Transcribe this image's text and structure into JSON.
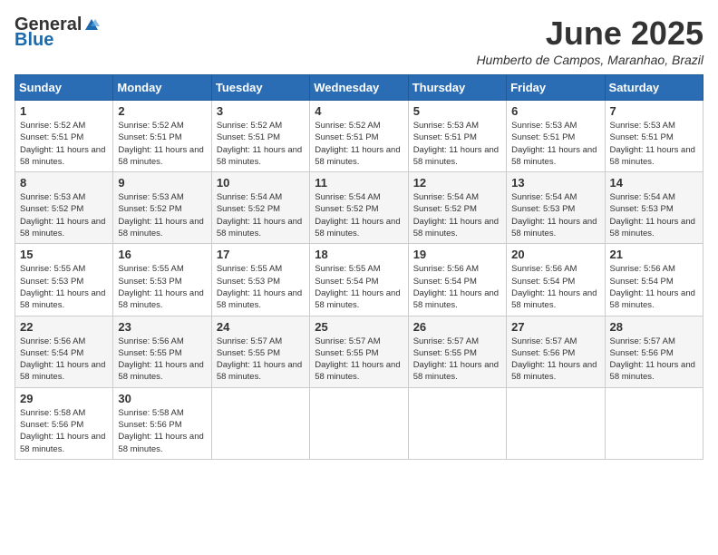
{
  "header": {
    "logo_general": "General",
    "logo_blue": "Blue",
    "month_title": "June 2025",
    "subtitle": "Humberto de Campos, Maranhao, Brazil"
  },
  "weekdays": [
    "Sunday",
    "Monday",
    "Tuesday",
    "Wednesday",
    "Thursday",
    "Friday",
    "Saturday"
  ],
  "weeks": [
    [
      {
        "day": "1",
        "sunrise": "5:52 AM",
        "sunset": "5:51 PM",
        "daylight": "11 hours and 58 minutes."
      },
      {
        "day": "2",
        "sunrise": "5:52 AM",
        "sunset": "5:51 PM",
        "daylight": "11 hours and 58 minutes."
      },
      {
        "day": "3",
        "sunrise": "5:52 AM",
        "sunset": "5:51 PM",
        "daylight": "11 hours and 58 minutes."
      },
      {
        "day": "4",
        "sunrise": "5:52 AM",
        "sunset": "5:51 PM",
        "daylight": "11 hours and 58 minutes."
      },
      {
        "day": "5",
        "sunrise": "5:53 AM",
        "sunset": "5:51 PM",
        "daylight": "11 hours and 58 minutes."
      },
      {
        "day": "6",
        "sunrise": "5:53 AM",
        "sunset": "5:51 PM",
        "daylight": "11 hours and 58 minutes."
      },
      {
        "day": "7",
        "sunrise": "5:53 AM",
        "sunset": "5:51 PM",
        "daylight": "11 hours and 58 minutes."
      }
    ],
    [
      {
        "day": "8",
        "sunrise": "5:53 AM",
        "sunset": "5:52 PM",
        "daylight": "11 hours and 58 minutes."
      },
      {
        "day": "9",
        "sunrise": "5:53 AM",
        "sunset": "5:52 PM",
        "daylight": "11 hours and 58 minutes."
      },
      {
        "day": "10",
        "sunrise": "5:54 AM",
        "sunset": "5:52 PM",
        "daylight": "11 hours and 58 minutes."
      },
      {
        "day": "11",
        "sunrise": "5:54 AM",
        "sunset": "5:52 PM",
        "daylight": "11 hours and 58 minutes."
      },
      {
        "day": "12",
        "sunrise": "5:54 AM",
        "sunset": "5:52 PM",
        "daylight": "11 hours and 58 minutes."
      },
      {
        "day": "13",
        "sunrise": "5:54 AM",
        "sunset": "5:53 PM",
        "daylight": "11 hours and 58 minutes."
      },
      {
        "day": "14",
        "sunrise": "5:54 AM",
        "sunset": "5:53 PM",
        "daylight": "11 hours and 58 minutes."
      }
    ],
    [
      {
        "day": "15",
        "sunrise": "5:55 AM",
        "sunset": "5:53 PM",
        "daylight": "11 hours and 58 minutes."
      },
      {
        "day": "16",
        "sunrise": "5:55 AM",
        "sunset": "5:53 PM",
        "daylight": "11 hours and 58 minutes."
      },
      {
        "day": "17",
        "sunrise": "5:55 AM",
        "sunset": "5:53 PM",
        "daylight": "11 hours and 58 minutes."
      },
      {
        "day": "18",
        "sunrise": "5:55 AM",
        "sunset": "5:54 PM",
        "daylight": "11 hours and 58 minutes."
      },
      {
        "day": "19",
        "sunrise": "5:56 AM",
        "sunset": "5:54 PM",
        "daylight": "11 hours and 58 minutes."
      },
      {
        "day": "20",
        "sunrise": "5:56 AM",
        "sunset": "5:54 PM",
        "daylight": "11 hours and 58 minutes."
      },
      {
        "day": "21",
        "sunrise": "5:56 AM",
        "sunset": "5:54 PM",
        "daylight": "11 hours and 58 minutes."
      }
    ],
    [
      {
        "day": "22",
        "sunrise": "5:56 AM",
        "sunset": "5:54 PM",
        "daylight": "11 hours and 58 minutes."
      },
      {
        "day": "23",
        "sunrise": "5:56 AM",
        "sunset": "5:55 PM",
        "daylight": "11 hours and 58 minutes."
      },
      {
        "day": "24",
        "sunrise": "5:57 AM",
        "sunset": "5:55 PM",
        "daylight": "11 hours and 58 minutes."
      },
      {
        "day": "25",
        "sunrise": "5:57 AM",
        "sunset": "5:55 PM",
        "daylight": "11 hours and 58 minutes."
      },
      {
        "day": "26",
        "sunrise": "5:57 AM",
        "sunset": "5:55 PM",
        "daylight": "11 hours and 58 minutes."
      },
      {
        "day": "27",
        "sunrise": "5:57 AM",
        "sunset": "5:56 PM",
        "daylight": "11 hours and 58 minutes."
      },
      {
        "day": "28",
        "sunrise": "5:57 AM",
        "sunset": "5:56 PM",
        "daylight": "11 hours and 58 minutes."
      }
    ],
    [
      {
        "day": "29",
        "sunrise": "5:58 AM",
        "sunset": "5:56 PM",
        "daylight": "11 hours and 58 minutes."
      },
      {
        "day": "30",
        "sunrise": "5:58 AM",
        "sunset": "5:56 PM",
        "daylight": "11 hours and 58 minutes."
      },
      null,
      null,
      null,
      null,
      null
    ]
  ]
}
